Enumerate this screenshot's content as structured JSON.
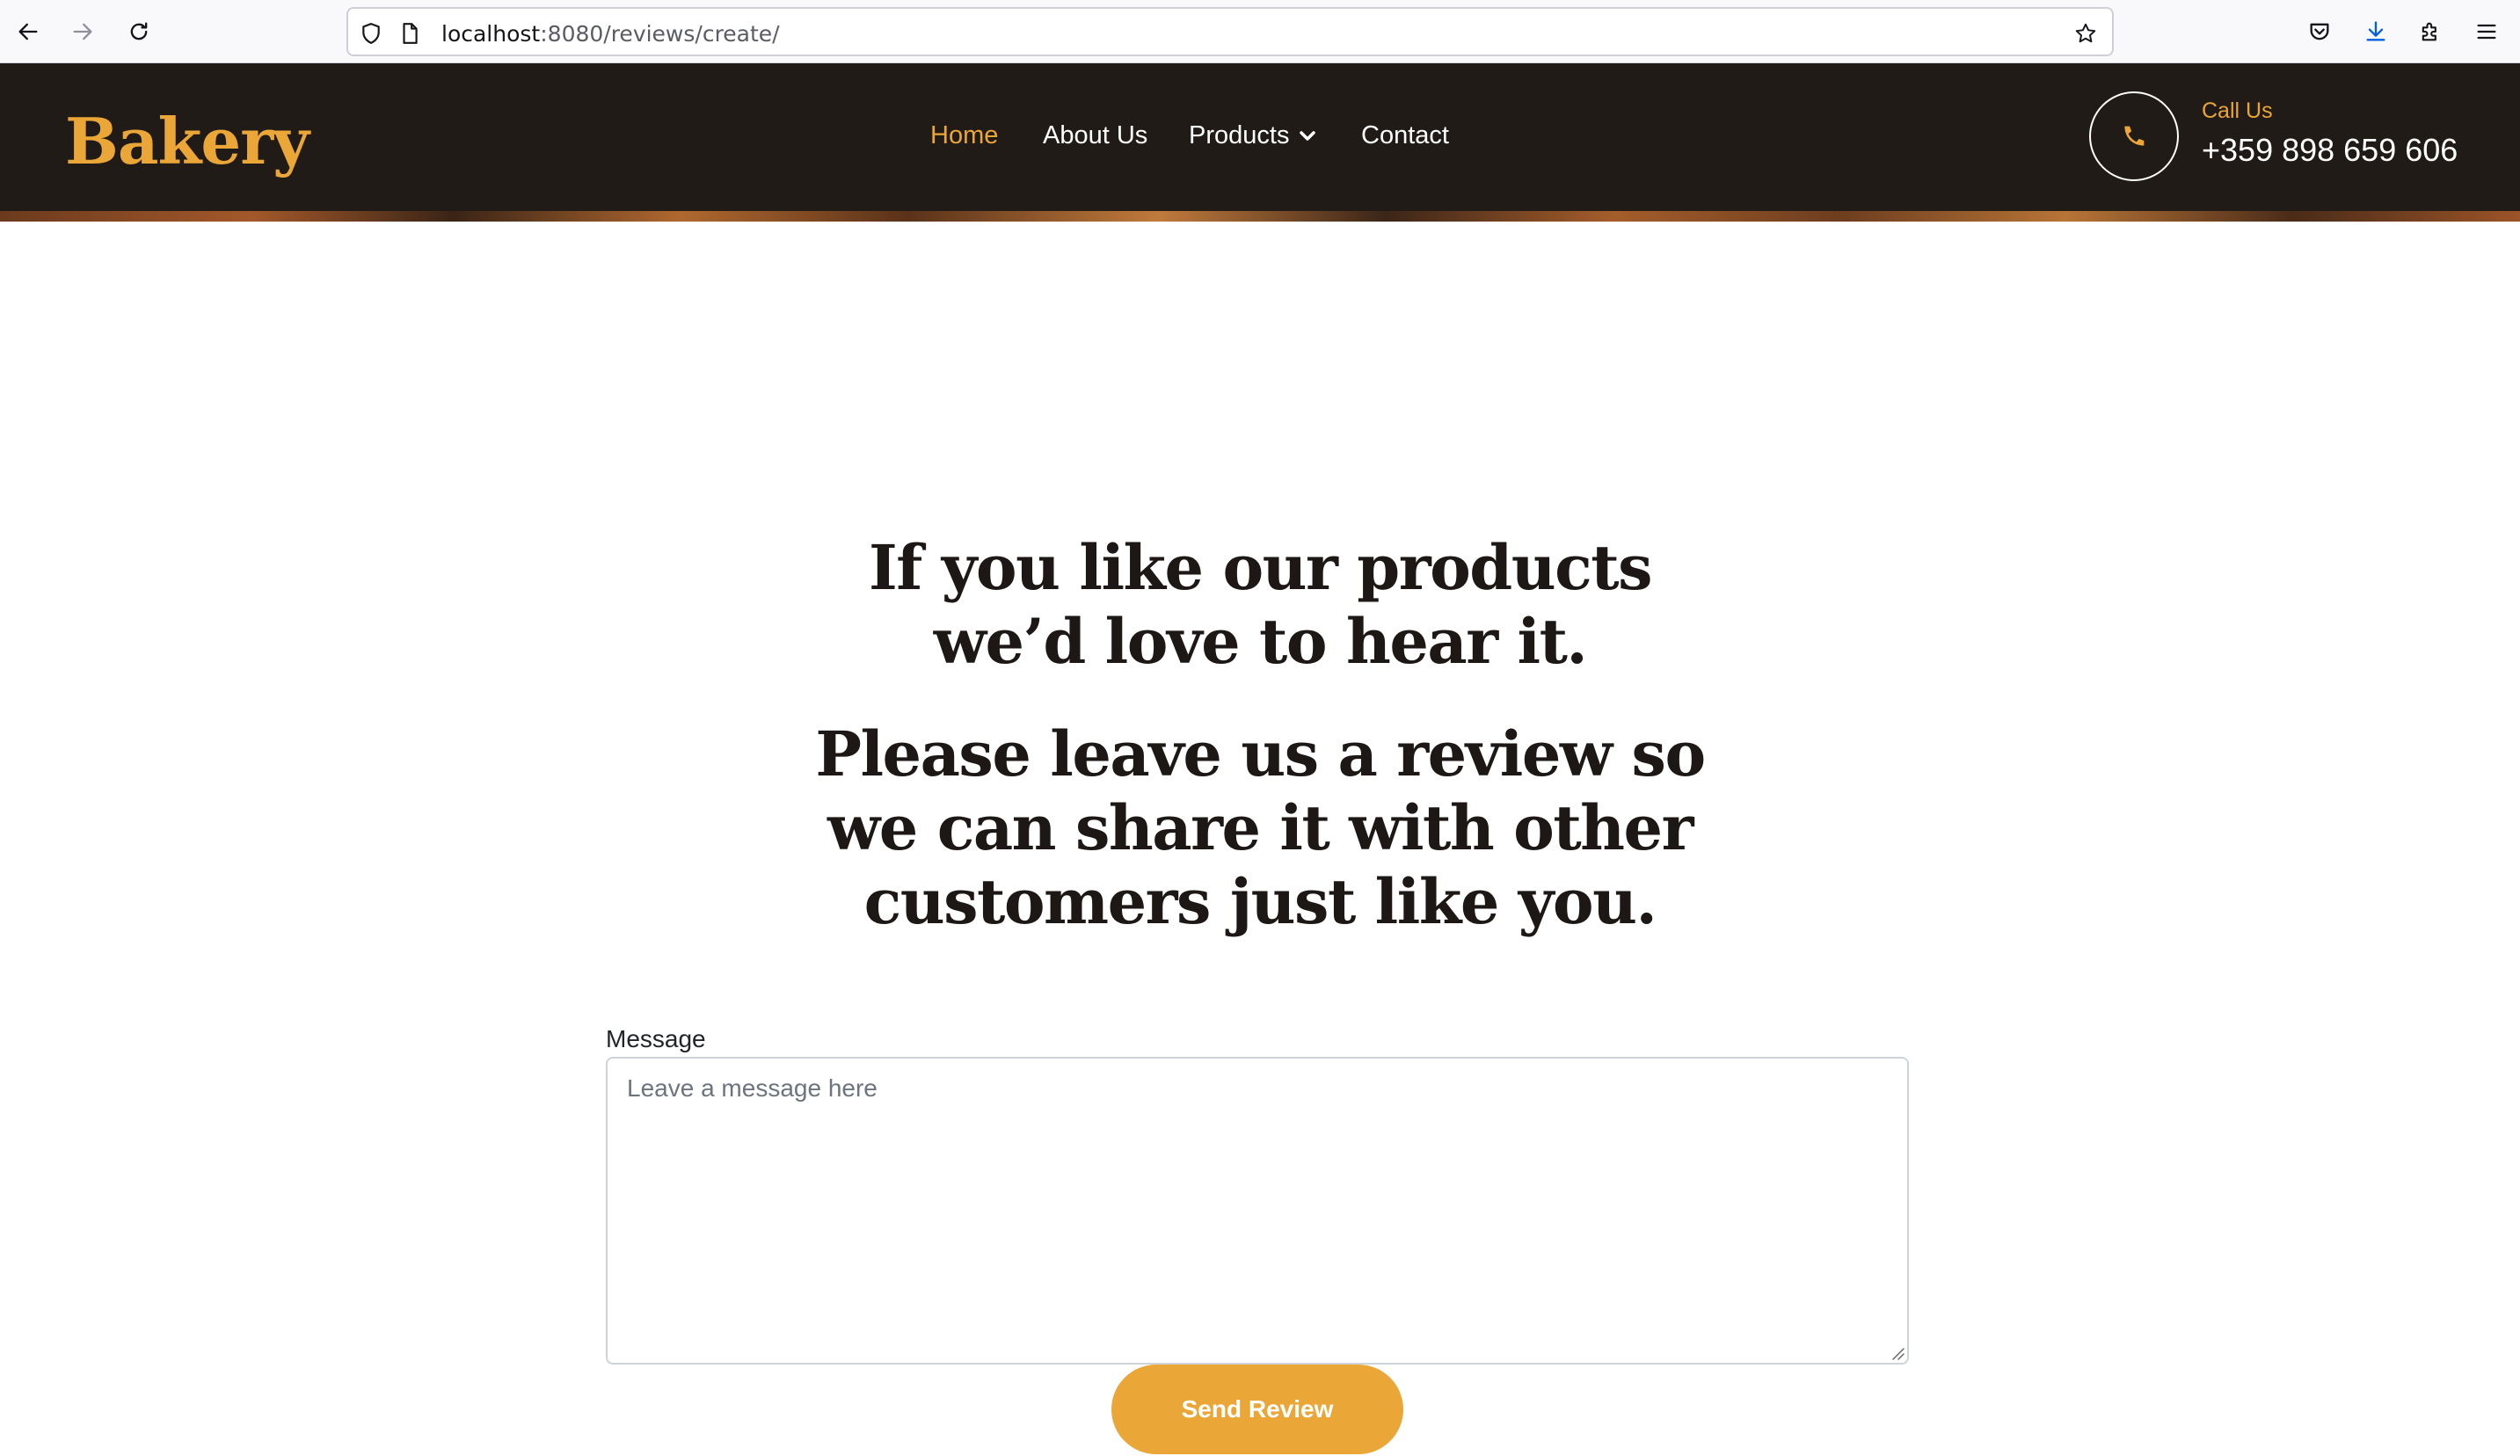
{
  "browser": {
    "url_host": "localhost",
    "url_rest": ":8080/reviews/create/"
  },
  "site": {
    "logo": "Bakery",
    "nav": [
      {
        "label": "Home",
        "active": true
      },
      {
        "label": "About Us"
      },
      {
        "label": "Products",
        "has_dropdown": true
      },
      {
        "label": "Contact"
      }
    ],
    "call_label": "Call Us",
    "call_number": "+359 898 659 606"
  },
  "content": {
    "heading_1_line_1": "If you like our products",
    "heading_1_line_2": "we’d love to hear it.",
    "heading_2_line_1": "Please leave us a review so",
    "heading_2_line_2": "we can share it with other",
    "heading_2_line_3": "customers just like you."
  },
  "form": {
    "message_label": "Message",
    "message_placeholder": "Leave a message here",
    "message_value": "",
    "submit_label": "Send Review"
  },
  "colors": {
    "accent": "#eaa636",
    "header_bg": "#211b17",
    "heading_text": "#1d1815"
  }
}
